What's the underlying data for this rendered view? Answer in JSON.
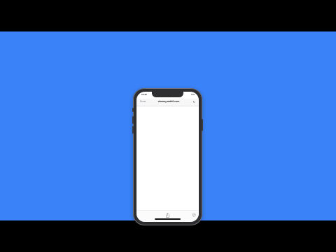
{
  "status_bar": {
    "time": "12:40",
    "right": "100"
  },
  "nav": {
    "done_label": "Done",
    "url": "dummy.auth0.com",
    "reload_icon": "reload-icon"
  },
  "toolbar": {
    "share_icon": "share-icon",
    "compass_icon": "compass-icon"
  },
  "colors": {
    "background": "#3a82f7",
    "letterbox": "#000000",
    "phone_frame": "#2e2e30",
    "screen": "#ffffff"
  }
}
